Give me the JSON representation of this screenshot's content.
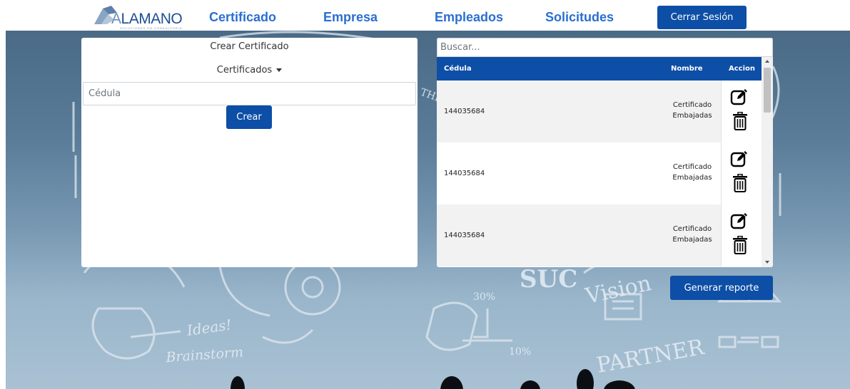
{
  "brand": {
    "name_first": "A",
    "name_rest": "LAMANO",
    "tagline": "SOLUCIONES EN CONSULTORIA"
  },
  "nav": {
    "items": [
      {
        "label": "Certificado"
      },
      {
        "label": "Empresa"
      },
      {
        "label": "Empleados"
      },
      {
        "label": "Solicitudes"
      }
    ],
    "logout_label": "Cerrar Sesión"
  },
  "create_panel": {
    "title": "Crear Certificado",
    "dropdown_label": "Certificados",
    "cedula_placeholder": "Cédula",
    "create_button": "Crear"
  },
  "list_panel": {
    "search_placeholder": "Buscar...",
    "columns": [
      "Cédula",
      "Nombre",
      "Accion"
    ],
    "rows": [
      {
        "cedula": "144035684",
        "nombre_line1": "Certificado",
        "nombre_line2": "Embajadas"
      },
      {
        "cedula": "144035684",
        "nombre_line1": "Certificado",
        "nombre_line2": "Embajadas"
      },
      {
        "cedula": "144035684",
        "nombre_line1": "Certificado",
        "nombre_line2": "Embajadas"
      }
    ]
  },
  "report_button": "Generar reporte",
  "background_text": {
    "ideas": "Ideas!",
    "brainstorm": "Brainstorm",
    "vision": "Vision",
    "partner": "PARTNER",
    "percent_30": "30%",
    "percent_10": "10%",
    "the": "THE",
    "suc": "SUC"
  },
  "colors": {
    "primary": "#0d4ea6",
    "nav_link": "#2a6fd1",
    "row_alt": "#f2f2f2"
  }
}
